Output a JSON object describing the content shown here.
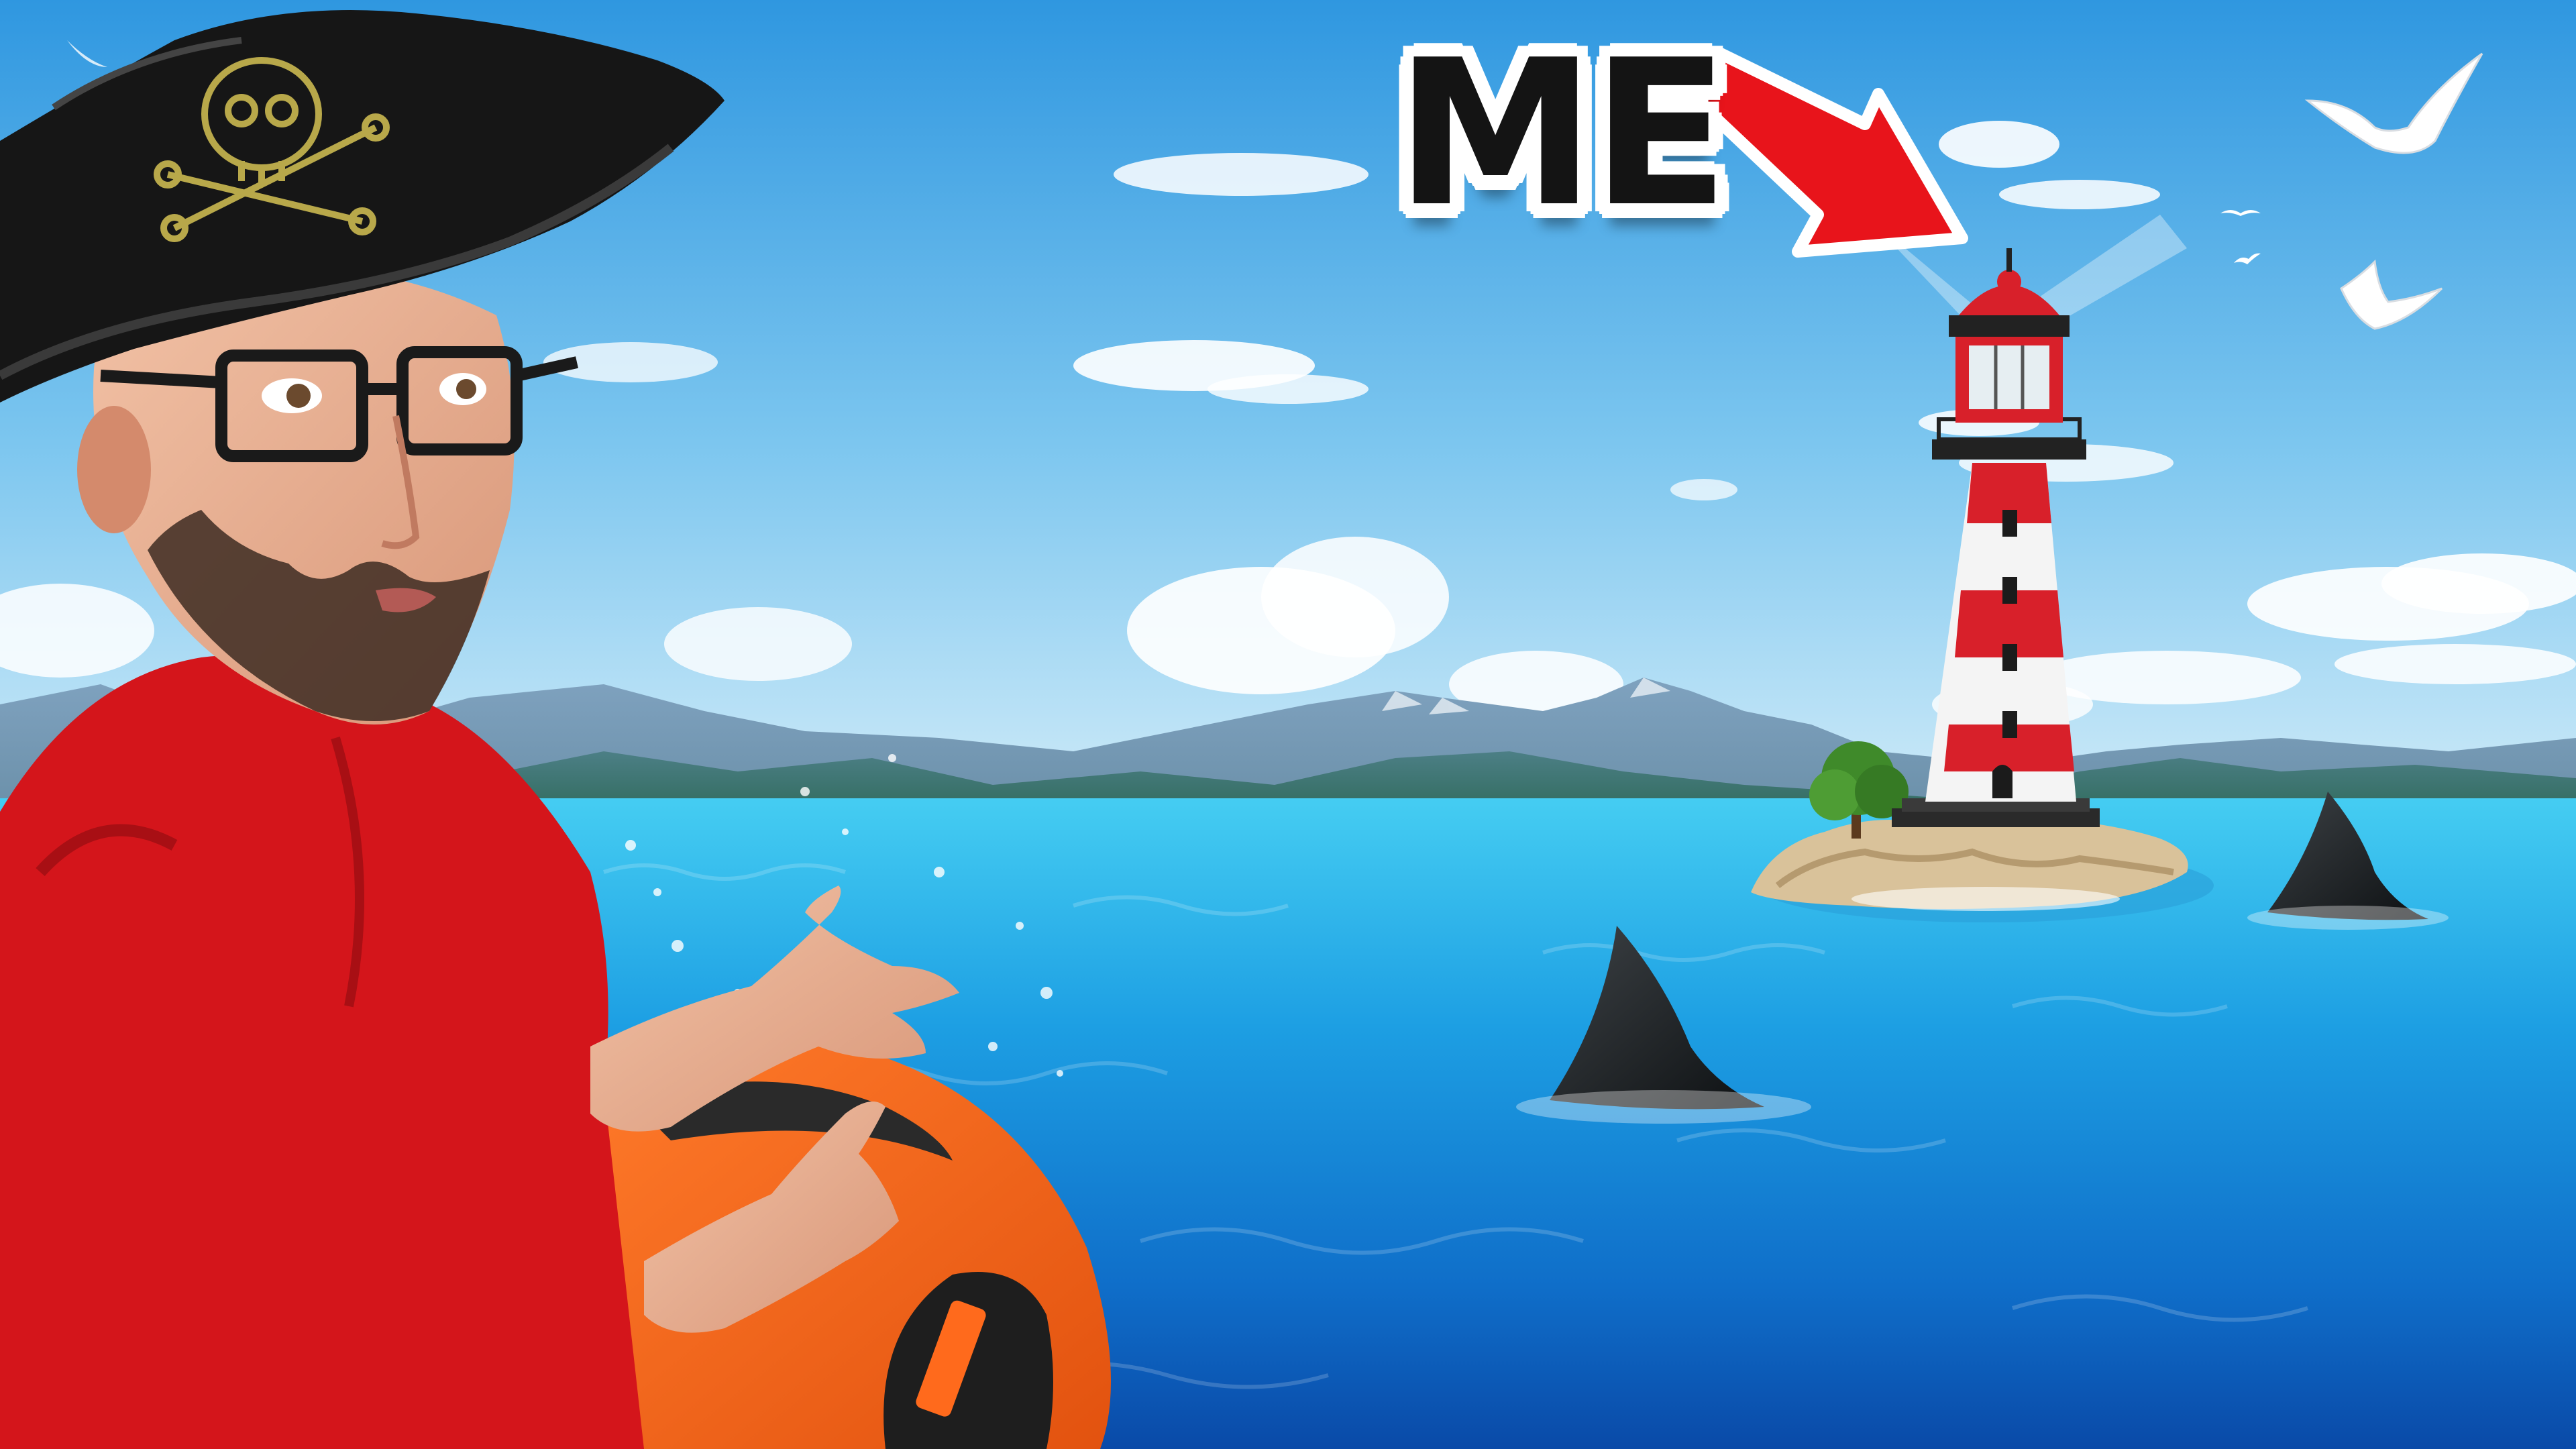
{
  "thumbnail": {
    "callout_text": "ME"
  },
  "colors": {
    "sky_top": "#3a9fe3",
    "sky_bottom": "#bfe4f7",
    "sea_far": "#3fc8f0",
    "sea_near": "#0c4fb0",
    "arrow": "#e8141b",
    "lighthouse_red": "#d8202a",
    "lighthouse_white": "#f4f4f4",
    "shirt": "#d4151b",
    "float_orange": "#ff6a1c",
    "hat": "#161616",
    "skull_gold": "#b8a84a"
  },
  "icons": [
    "pirate-hat-skull-icon",
    "red-arrow-icon",
    "seagull-icon",
    "shark-fin-icon"
  ]
}
